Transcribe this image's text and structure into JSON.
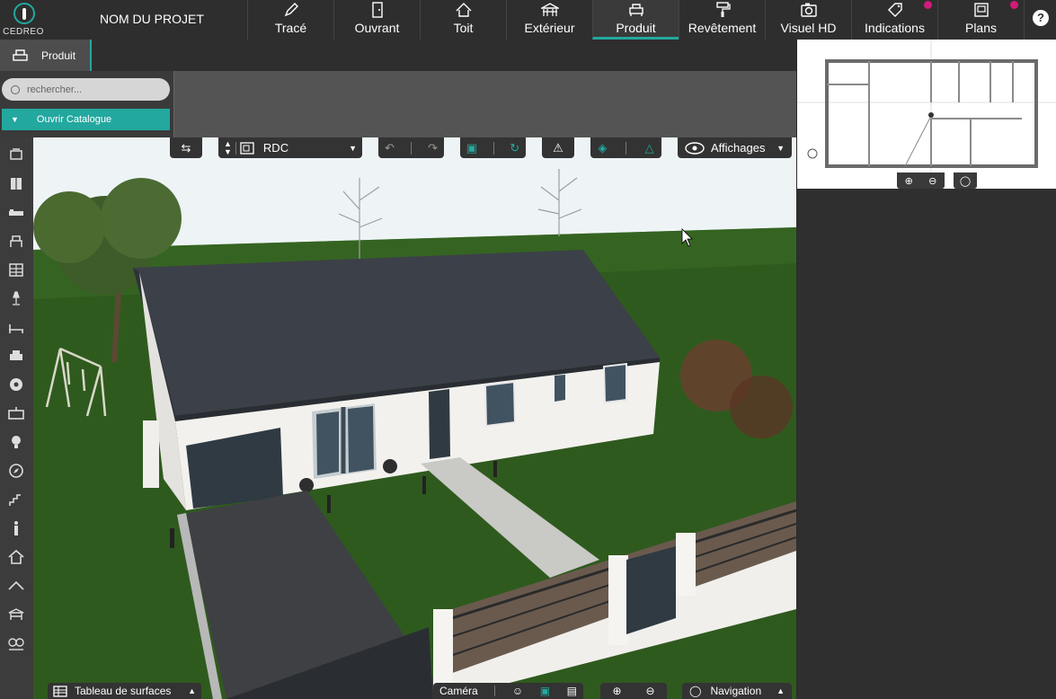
{
  "app": {
    "logo_text": "CEDREO",
    "project_name": "NOM DU PROJET"
  },
  "nav": {
    "tabs": [
      {
        "label": "Tracé",
        "icon": "pencil-icon"
      },
      {
        "label": "Ouvrant",
        "icon": "door-icon"
      },
      {
        "label": "Toit",
        "icon": "roof-icon"
      },
      {
        "label": "Extérieur",
        "icon": "pergola-icon"
      },
      {
        "label": "Produit",
        "icon": "sofa-icon",
        "active": true
      },
      {
        "label": "Revêtement",
        "icon": "paint-roller-icon"
      },
      {
        "label": "Visuel HD",
        "icon": "camera-icon"
      },
      {
        "label": "Indications",
        "icon": "tags-icon",
        "badge": true
      },
      {
        "label": "Plans",
        "icon": "plans-icon",
        "badge": true
      }
    ],
    "help_label": "?"
  },
  "subtab": {
    "label": "Produit"
  },
  "panel": {
    "search_placeholder": "rechercher...",
    "catalogue_label": "Ouvrir Catalogue"
  },
  "view_toolbar": {
    "level_label": "RDC",
    "display_label": "Affichages"
  },
  "bottom": {
    "surfaces_label": "Tableau de surfaces",
    "camera_label": "Caméra",
    "navigation_label": "Navigation"
  },
  "colors": {
    "accent": "#23a89f",
    "badge": "#d11b7a",
    "topbar": "#2e2e2e"
  },
  "left_tools": [
    "wall-object-icon",
    "cabinet-icon",
    "bed-icon",
    "chair-icon",
    "shelf-icon",
    "lamp-icon",
    "bench-icon",
    "armchair-icon",
    "ball-icon",
    "sink-icon",
    "bulb-icon",
    "compass-icon",
    "stairs-icon",
    "person-icon",
    "house-icon",
    "roof-line-icon",
    "gazebo-icon",
    "tree-icon"
  ]
}
